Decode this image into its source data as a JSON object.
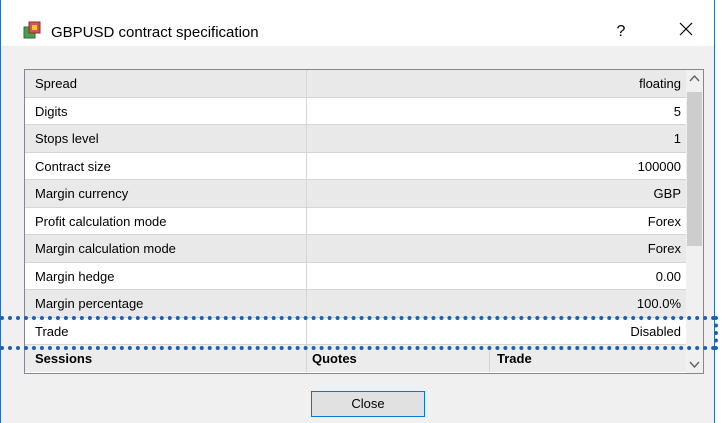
{
  "window": {
    "title": "GBPUSD contract specification",
    "help_label": "?",
    "close_icon": "close-icon",
    "app_icon": "metatrader-app-icon"
  },
  "spec_rows": [
    {
      "name": "Spread",
      "value": "floating"
    },
    {
      "name": "Digits",
      "value": "5"
    },
    {
      "name": "Stops level",
      "value": "1"
    },
    {
      "name": "Contract size",
      "value": "100000"
    },
    {
      "name": "Margin currency",
      "value": "GBP"
    },
    {
      "name": "Profit calculation mode",
      "value": "Forex"
    },
    {
      "name": "Margin calculation mode",
      "value": "Forex"
    },
    {
      "name": "Margin hedge",
      "value": "0.00"
    },
    {
      "name": "Margin percentage",
      "value": "100.0%"
    },
    {
      "name": "Trade",
      "value": "Disabled"
    }
  ],
  "sessions_header": {
    "sessions": "Sessions",
    "quotes": "Quotes",
    "trade": "Trade"
  },
  "footer": {
    "close_label": "Close"
  },
  "colors": {
    "highlight_dotted": "#1f5fb4",
    "button_focus_border": "#0078d7",
    "row_alt": "#e9e9e9"
  }
}
